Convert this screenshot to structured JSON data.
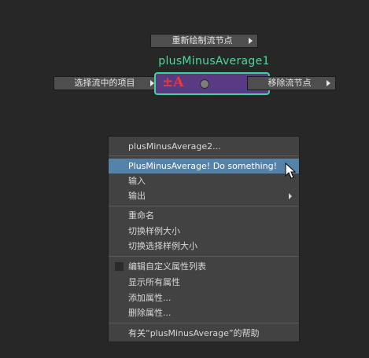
{
  "node_editor": {
    "redraw_button": "重新绘制流节点",
    "node_title": "plusMinusAverage1",
    "node_icon_symbol": "±A",
    "select_in_stream_button": "选择流中的项目",
    "remove_node_button": "移除流节点"
  },
  "context_menu": {
    "items": [
      {
        "label": "plusMinusAverage2..."
      },
      {
        "label": "PlusMinusAverage! Do something!",
        "highlighted": true
      },
      {
        "label": "输入"
      },
      {
        "label": "输出",
        "submenu": true
      },
      {
        "label": "重命名"
      },
      {
        "label": "切换样例大小"
      },
      {
        "label": "切换选择样例大小"
      },
      {
        "label": "编辑自定义属性列表",
        "checkbox": true
      },
      {
        "label": "显示所有属性"
      },
      {
        "label": "添加属性..."
      },
      {
        "label": "删除属性..."
      },
      {
        "label": "有关“plusMinusAverage”的帮助"
      }
    ]
  },
  "colors": {
    "background": "#272727",
    "node_fill": "#5a3a82",
    "node_border": "#39d79a",
    "node_title": "#4bdb9a",
    "menu_highlight": "#5582a8"
  }
}
